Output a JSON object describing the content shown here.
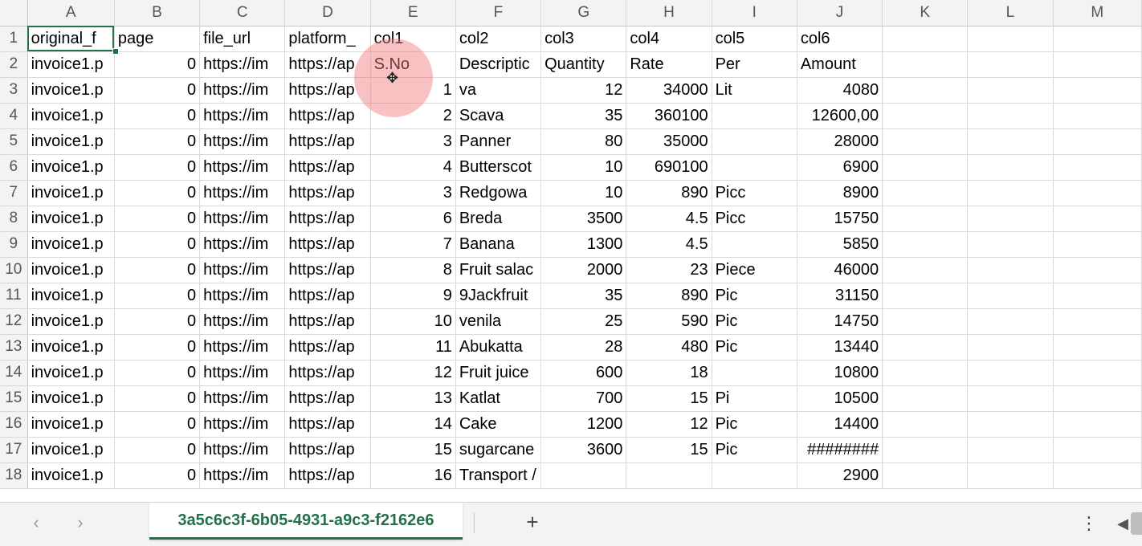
{
  "columns": [
    "A",
    "B",
    "C",
    "D",
    "E",
    "F",
    "G",
    "H",
    "I",
    "J",
    "K",
    "L",
    "M"
  ],
  "rows": [
    {
      "n": "1",
      "cells": [
        "original_f",
        "page",
        "file_url",
        "platform_",
        "col1",
        "col2",
        "col3",
        "col4",
        "col5",
        "col6",
        "",
        "",
        ""
      ]
    },
    {
      "n": "2",
      "cells": [
        "invoice1.p",
        "0",
        "https://im",
        "https://ap",
        "S.No",
        "Descriptic",
        "Quantity",
        "Rate",
        "Per",
        "Amount",
        "",
        "",
        ""
      ]
    },
    {
      "n": "3",
      "cells": [
        "invoice1.p",
        "0",
        "https://im",
        "https://ap",
        "1",
        "va",
        "12",
        "34000",
        "Lit",
        "4080",
        "",
        "",
        ""
      ]
    },
    {
      "n": "4",
      "cells": [
        "invoice1.p",
        "0",
        "https://im",
        "https://ap",
        "2",
        "Scava",
        "35",
        "360100",
        "",
        "12600,00",
        "",
        "",
        ""
      ]
    },
    {
      "n": "5",
      "cells": [
        "invoice1.p",
        "0",
        "https://im",
        "https://ap",
        "3",
        "Panner",
        "80",
        "35000",
        "",
        "28000",
        "",
        "",
        ""
      ]
    },
    {
      "n": "6",
      "cells": [
        "invoice1.p",
        "0",
        "https://im",
        "https://ap",
        "4",
        "Butterscot",
        "10",
        "690100",
        "",
        "6900",
        "",
        "",
        ""
      ]
    },
    {
      "n": "7",
      "cells": [
        "invoice1.p",
        "0",
        "https://im",
        "https://ap",
        "3",
        "Redgowa",
        "10",
        "890",
        "Picc",
        "8900",
        "",
        "",
        ""
      ]
    },
    {
      "n": "8",
      "cells": [
        "invoice1.p",
        "0",
        "https://im",
        "https://ap",
        "6",
        "Breda",
        "3500",
        "4.5",
        "Picc",
        "15750",
        "",
        "",
        ""
      ]
    },
    {
      "n": "9",
      "cells": [
        "invoice1.p",
        "0",
        "https://im",
        "https://ap",
        "7",
        "Banana",
        "1300",
        "4.5",
        "",
        "5850",
        "",
        "",
        ""
      ]
    },
    {
      "n": "10",
      "cells": [
        "invoice1.p",
        "0",
        "https://im",
        "https://ap",
        "8",
        "Fruit salac",
        "2000",
        "23",
        "Piece",
        "46000",
        "",
        "",
        ""
      ]
    },
    {
      "n": "11",
      "cells": [
        "invoice1.p",
        "0",
        "https://im",
        "https://ap",
        "9",
        "9Jackfruit",
        "35",
        "890",
        "Pic",
        "31150",
        "",
        "",
        ""
      ]
    },
    {
      "n": "12",
      "cells": [
        "invoice1.p",
        "0",
        "https://im",
        "https://ap",
        "10",
        "venila",
        "25",
        "590",
        "Pic",
        "14750",
        "",
        "",
        ""
      ]
    },
    {
      "n": "13",
      "cells": [
        "invoice1.p",
        "0",
        "https://im",
        "https://ap",
        "11",
        "Abukatta",
        "28",
        "480",
        "Pic",
        "13440",
        "",
        "",
        ""
      ]
    },
    {
      "n": "14",
      "cells": [
        "invoice1.p",
        "0",
        "https://im",
        "https://ap",
        "12",
        "Fruit juice",
        "600",
        "18",
        "",
        "10800",
        "",
        "",
        ""
      ]
    },
    {
      "n": "15",
      "cells": [
        "invoice1.p",
        "0",
        "https://im",
        "https://ap",
        "13",
        "Katlat",
        "700",
        "15",
        "Pi",
        "10500",
        "",
        "",
        ""
      ]
    },
    {
      "n": "16",
      "cells": [
        "invoice1.p",
        "0",
        "https://im",
        "https://ap",
        "14",
        "Cake",
        "1200",
        "12",
        "Pic",
        "14400",
        "",
        "",
        ""
      ]
    },
    {
      "n": "17",
      "cells": [
        "invoice1.p",
        "0",
        "https://im",
        "https://ap",
        "15",
        "sugarcane",
        "3600",
        "15",
        "Pic",
        "########",
        "",
        "",
        ""
      ]
    },
    {
      "n": "18",
      "cells": [
        "invoice1.p",
        "0",
        "https://im",
        "https://ap",
        "16",
        "Transport / Service",
        "",
        "",
        "",
        "2900",
        "",
        "",
        ""
      ]
    }
  ],
  "sheetbar": {
    "prev_icon": "‹",
    "next_icon": "›",
    "active_sheet": "3a5c6c3f-6b05-4931-a9c3-f2162e6",
    "add_icon": "+",
    "more_icon": "⋮",
    "scroll_left_icon": "◀"
  },
  "cursor_icon": "✥"
}
